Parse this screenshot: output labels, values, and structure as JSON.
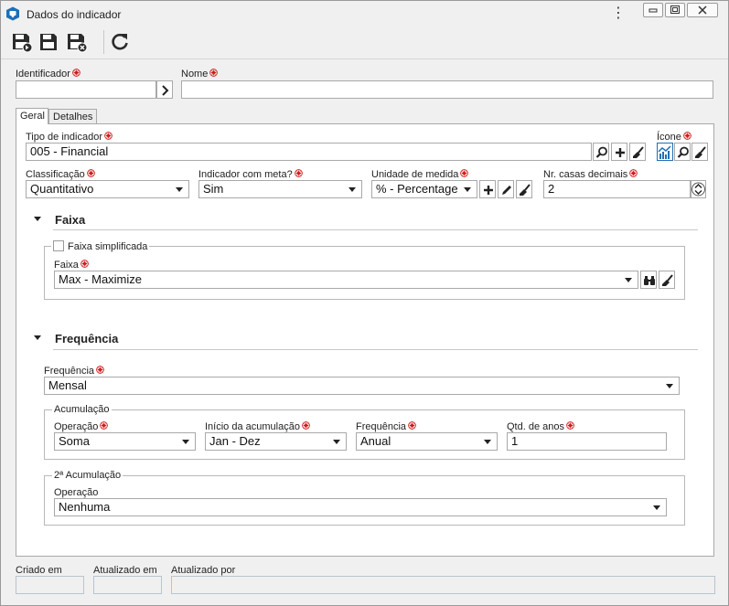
{
  "window": {
    "title": "Dados do indicador"
  },
  "colors": {
    "required": "#d01818",
    "accent": "#1f6fb5",
    "panel_border": "#a9a9a9"
  },
  "toolbar": {
    "buttons": [
      {
        "name": "save-and-new",
        "icon": "save-plus-icon"
      },
      {
        "name": "save",
        "icon": "save-icon"
      },
      {
        "name": "save-and-close",
        "icon": "save-close-icon"
      },
      {
        "name": "refresh",
        "icon": "refresh-icon"
      }
    ]
  },
  "header": {
    "identificador_label": "Identificador",
    "identificador_value": "",
    "nome_label": "Nome",
    "nome_value": ""
  },
  "tabs": [
    {
      "label": "Geral",
      "active": true
    },
    {
      "label": "Detalhes",
      "active": false
    }
  ],
  "geral": {
    "tipo_label": "Tipo de indicador",
    "tipo_value": "005 - Financial",
    "icone_label": "Ícone",
    "classificacao_label": "Classificação",
    "classificacao_value": "Quantitativo",
    "meta_label": "Indicador com meta?",
    "meta_value": "Sim",
    "unidade_label": "Unidade de medida",
    "unidade_value": "% - Percentage",
    "casas_label": "Nr. casas decimais",
    "casas_value": "2"
  },
  "faixa": {
    "section_title": "Faixa",
    "simplificada_label": "Faixa simplificada",
    "simplificada_checked": false,
    "faixa_label": "Faixa",
    "faixa_value": "Max - Maximize"
  },
  "frequencia": {
    "section_title": "Frequência",
    "frequencia_label": "Frequência",
    "frequencia_value": "Mensal",
    "acumulacao": {
      "legend": "Acumulação",
      "operacao_label": "Operação",
      "operacao_value": "Soma",
      "inicio_label": "Início da acumulação",
      "inicio_value": "Jan - Dez",
      "frequencia_label": "Frequência",
      "frequencia_value": "Anual",
      "qtd_label": "Qtd. de anos",
      "qtd_value": "1"
    },
    "acumulacao2": {
      "legend": "2ª Acumulação",
      "operacao_label": "Operação",
      "operacao_value": "Nenhuma"
    }
  },
  "footer": {
    "criado_label": "Criado em",
    "criado_value": "",
    "atualizado_label": "Atualizado em",
    "atualizado_value": "",
    "atualizado_por_label": "Atualizado por",
    "atualizado_por_value": ""
  }
}
